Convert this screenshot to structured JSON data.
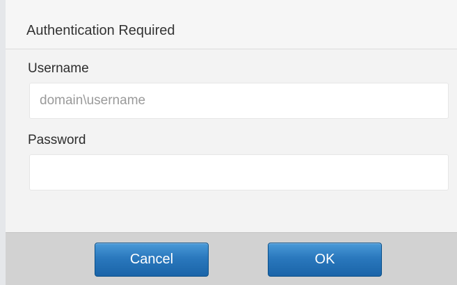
{
  "dialog": {
    "title": "Authentication Required",
    "username": {
      "label": "Username",
      "placeholder": "domain\\username",
      "value": ""
    },
    "password": {
      "label": "Password",
      "placeholder": "",
      "value": ""
    },
    "buttons": {
      "cancel_label": "Cancel",
      "ok_label": "OK"
    }
  },
  "colors": {
    "button_blue": "#2a78bd",
    "button_bar": "#d2d2d2",
    "dialog_background": "#f3f3f3"
  }
}
